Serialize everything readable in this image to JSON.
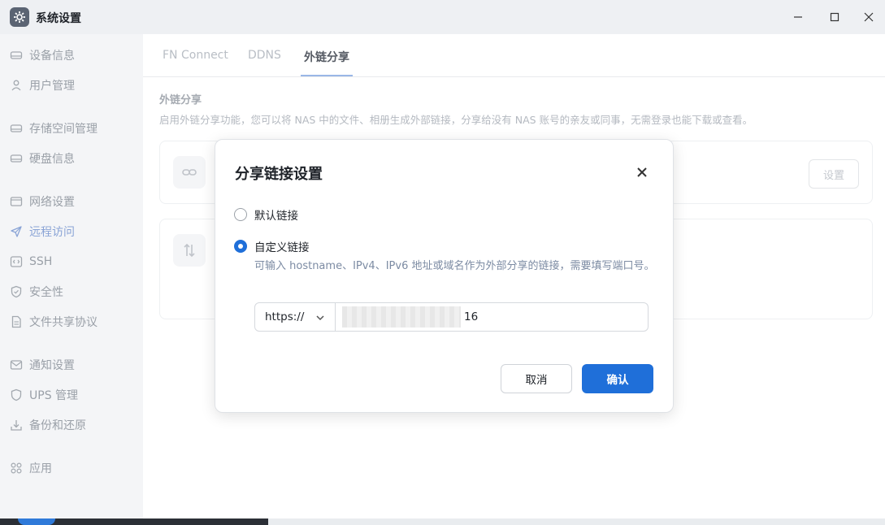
{
  "window": {
    "title": "系统设置",
    "app_icon": "gear-icon",
    "controls": [
      "minimize-icon",
      "maximize-icon",
      "close-icon"
    ]
  },
  "sidebar": {
    "items": [
      {
        "label": "设备信息",
        "icon": "drive-icon"
      },
      {
        "label": "用户管理",
        "icon": "user-icon"
      },
      {
        "label": "存储空间管理",
        "icon": "storage-icon"
      },
      {
        "label": "硬盘信息",
        "icon": "disk-icon"
      },
      {
        "label": "网络设置",
        "icon": "network-icon"
      },
      {
        "label": "远程访问",
        "icon": "send-icon",
        "active": true
      },
      {
        "label": "SSH",
        "icon": "code-icon"
      },
      {
        "label": "安全性",
        "icon": "shield-icon"
      },
      {
        "label": "文件共享协议",
        "icon": "file-icon"
      },
      {
        "label": "通知设置",
        "icon": "mail-icon"
      },
      {
        "label": "UPS 管理",
        "icon": "shield-outline-icon"
      },
      {
        "label": "备份和还原",
        "icon": "download-icon"
      },
      {
        "label": "应用",
        "icon": "apps-icon"
      }
    ]
  },
  "main": {
    "tabs": [
      {
        "label": "FN Connect"
      },
      {
        "label": "DDNS"
      },
      {
        "label": "外链分享",
        "active": true
      }
    ],
    "section_title": "外链分享",
    "section_desc": "启用外链分享功能，您可以将 NAS 中的文件、相册生成外部链接，分享给没有 NAS 账号的亲友或同事，无需登录也能下载或查看。",
    "card1": {
      "icon": "link-icon",
      "button_label": "设置"
    },
    "card2": {
      "icon": "transfer-icon"
    }
  },
  "dialog": {
    "title": "分享链接设置",
    "options": [
      {
        "label": "默认链接",
        "checked": false
      },
      {
        "label": "自定义链接",
        "checked": true
      }
    ],
    "hint": "可输入 hostname、IPv4、IPv6 地址或域名作为外部分享的链接，需要填写端口号。",
    "protocol": "https://",
    "host_visible_suffix": "16",
    "cancel_label": "取消",
    "confirm_label": "确认",
    "accent_color": "#1f6fd9"
  }
}
